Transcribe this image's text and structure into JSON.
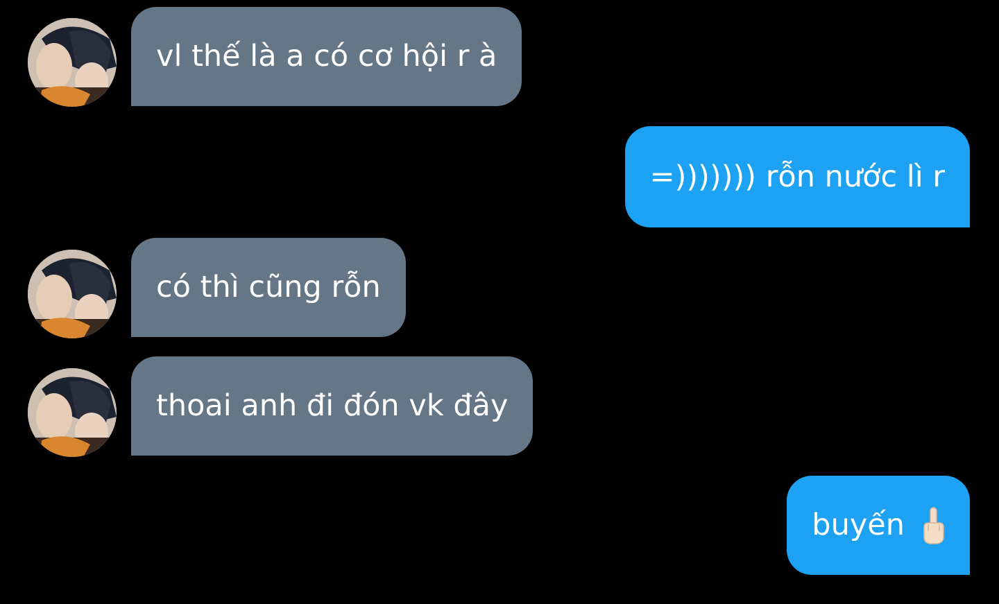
{
  "conversation": {
    "messages": [
      {
        "sender": "contact",
        "text": "vl thế là a có cơ hội r à"
      },
      {
        "sender": "me",
        "text": "=))))))) rỗn nước lì r"
      },
      {
        "sender": "contact",
        "text": "có thì cũng rỗn"
      },
      {
        "sender": "contact",
        "text": "thoai anh đi đón vk đây"
      },
      {
        "sender": "me",
        "text": "buyến",
        "emoji": "middle-finger-emoji"
      }
    ]
  },
  "colors": {
    "background": "#000000",
    "incoming_bubble": "#657687",
    "outgoing_bubble": "#1da1f2",
    "text": "#ffffff"
  }
}
